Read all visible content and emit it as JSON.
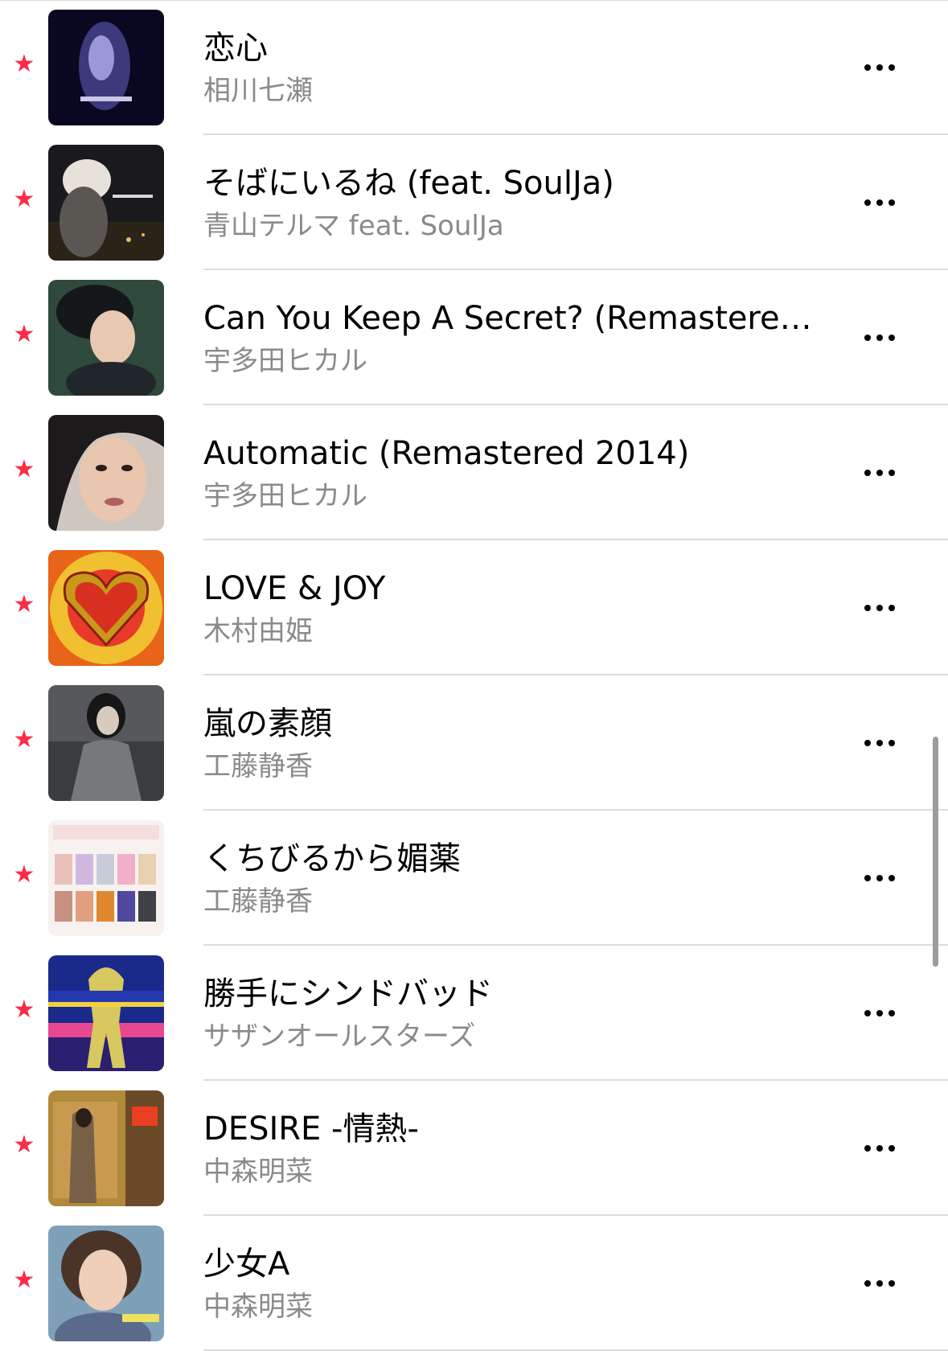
{
  "accent_color": "#fa2d48",
  "rows": [
    {
      "title": "恋心",
      "artist": "相川七瀬",
      "star_icon": "star-icon",
      "more_icon": "ellipsis-icon"
    },
    {
      "title": "そばにいるね (feat. SoulJa)",
      "artist": "青山テルマ feat. SoulJa",
      "star_icon": "star-icon",
      "more_icon": "ellipsis-icon"
    },
    {
      "title": "Can You Keep A Secret? (Remastered...",
      "artist": "宇多田ヒカル",
      "star_icon": "star-icon",
      "more_icon": "ellipsis-icon"
    },
    {
      "title": "Automatic (Remastered 2014)",
      "artist": "宇多田ヒカル",
      "star_icon": "star-icon",
      "more_icon": "ellipsis-icon"
    },
    {
      "title": "LOVE & JOY",
      "artist": "木村由姫",
      "star_icon": "star-icon",
      "more_icon": "ellipsis-icon"
    },
    {
      "title": "嵐の素顔",
      "artist": "工藤静香",
      "star_icon": "star-icon",
      "more_icon": "ellipsis-icon"
    },
    {
      "title": "くちびるから媚薬",
      "artist": "工藤静香",
      "star_icon": "star-icon",
      "more_icon": "ellipsis-icon"
    },
    {
      "title": "勝手にシンドバッド",
      "artist": "サザンオールスターズ",
      "star_icon": "star-icon",
      "more_icon": "ellipsis-icon"
    },
    {
      "title": "DESIRE -情熱-",
      "artist": "中森明菜",
      "star_icon": "star-icon",
      "more_icon": "ellipsis-icon"
    },
    {
      "title": "少女A",
      "artist": "中森明菜",
      "star_icon": "star-icon",
      "more_icon": "ellipsis-icon"
    }
  ]
}
